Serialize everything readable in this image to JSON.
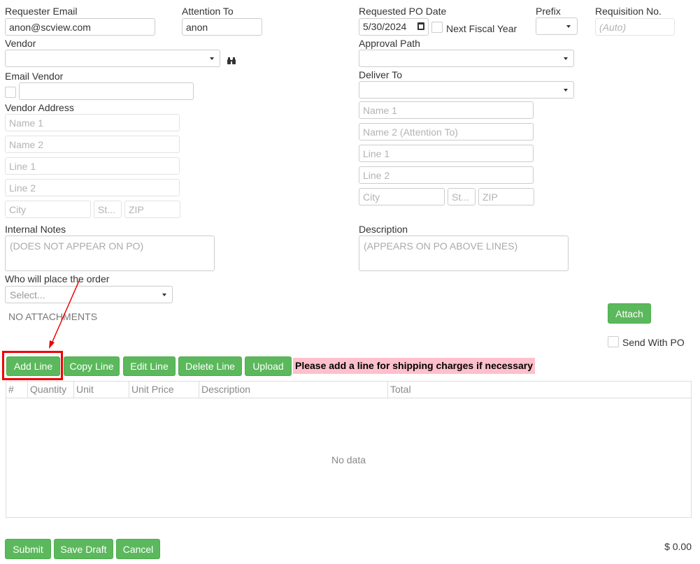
{
  "header": {
    "requester_email": {
      "label": "Requester Email",
      "value": "anon@scview.com"
    },
    "attention_to": {
      "label": "Attention To",
      "value": "anon"
    },
    "requested_po_date": {
      "label": "Requested PO Date",
      "value": "5/30/2024"
    },
    "next_fiscal_year": {
      "label": "Next Fiscal Year",
      "checked": false
    },
    "prefix": {
      "label": "Prefix",
      "value": ""
    },
    "requisition_no": {
      "label": "Requisition No.",
      "placeholder": "(Auto)"
    }
  },
  "vendor": {
    "label": "Vendor",
    "value": "",
    "search_icon": "binoculars-icon",
    "email_label": "Email Vendor",
    "email_checked": false,
    "email_value": "",
    "address_label": "Vendor Address",
    "address": {
      "name1": "Name 1",
      "name2": "Name 2",
      "line1": "Line 1",
      "line2": "Line 2",
      "city": "City",
      "state": "St...",
      "zip": "ZIP"
    }
  },
  "approval_path": {
    "label": "Approval Path",
    "value": ""
  },
  "deliver_to": {
    "label": "Deliver To",
    "value": "",
    "address": {
      "name1": "Name 1",
      "name2": "Name 2 (Attention To)",
      "line1": "Line 1",
      "line2": "Line 2",
      "city": "City",
      "state": "St...",
      "zip": "ZIP"
    }
  },
  "internal_notes": {
    "label": "Internal Notes",
    "placeholder": "(DOES NOT APPEAR ON PO)"
  },
  "description": {
    "label": "Description",
    "placeholder": "(APPEARS ON PO ABOVE LINES)"
  },
  "who_places_order": {
    "label": "Who will place the order",
    "value": "Select..."
  },
  "attachments": {
    "empty_text": "NO ATTACHMENTS",
    "attach_label": "Attach",
    "send_with_po_label": "Send With PO",
    "send_with_po_checked": false
  },
  "lines_toolbar": {
    "add_line": "Add Line",
    "copy_line": "Copy Line",
    "edit_line": "Edit Line",
    "delete_line": "Delete Line",
    "upload": "Upload",
    "notice": "Please add a line for shipping charges if necessary"
  },
  "lines_grid": {
    "columns": [
      "#",
      "Quantity",
      "Unit",
      "Unit Price",
      "Description",
      "Total"
    ],
    "empty_text": "No data"
  },
  "footer": {
    "submit": "Submit",
    "save_draft": "Save Draft",
    "cancel": "Cancel",
    "total": "$ 0.00"
  },
  "colors": {
    "button_green": "#5cb85c",
    "notice_bg": "#ffc0cb",
    "highlight_red": "#e00000"
  }
}
